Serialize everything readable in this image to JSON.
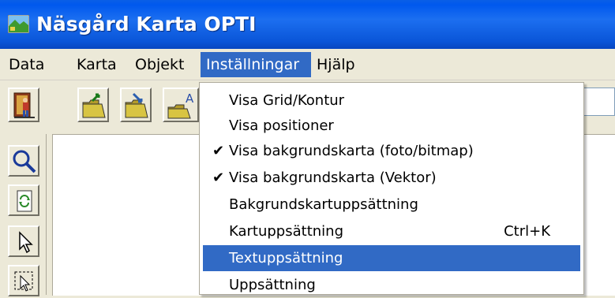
{
  "window": {
    "title": "Näsgård Karta OPTI"
  },
  "menubar": {
    "items": [
      {
        "label": "Data"
      },
      {
        "label": "Karta"
      },
      {
        "label": "Objekt"
      },
      {
        "label": "Inställningar"
      },
      {
        "label": "Hjälp"
      }
    ],
    "active_index": 3
  },
  "toolbar": {
    "buttons": [
      {
        "icon": "exit-door-icon"
      },
      {
        "icon": "open-folder-icon"
      },
      {
        "icon": "save-folder-icon"
      },
      {
        "icon": "text-folder-icon"
      }
    ]
  },
  "left_tools": {
    "buttons": [
      {
        "icon": "zoom-magnifier-icon"
      },
      {
        "icon": "refresh-icon"
      },
      {
        "icon": "select-pointer-icon"
      },
      {
        "icon": "selection-rectangle-icon"
      }
    ]
  },
  "dropdown": {
    "items": [
      {
        "label": "Visa Grid/Kontur",
        "checked": false,
        "shortcut": ""
      },
      {
        "label": "Visa positioner",
        "checked": false,
        "shortcut": ""
      },
      {
        "label": "Visa bakgrundskarta (foto/bitmap)",
        "checked": true,
        "shortcut": ""
      },
      {
        "label": "Visa bakgrundskarta (Vektor)",
        "checked": true,
        "shortcut": ""
      },
      {
        "label": "Bakgrundskartuppsättning",
        "checked": false,
        "shortcut": ""
      },
      {
        "label": "Kartuppsättning",
        "checked": false,
        "shortcut": "Ctrl+K"
      },
      {
        "label": "Textuppsättning",
        "checked": false,
        "shortcut": "",
        "highlighted": true
      },
      {
        "label": "Uppsättning",
        "checked": false,
        "shortcut": ""
      }
    ],
    "check_glyph": "✔"
  },
  "colors": {
    "titlebar": "#0a55d8",
    "highlight": "#316ac5",
    "face": "#ece9d8"
  }
}
